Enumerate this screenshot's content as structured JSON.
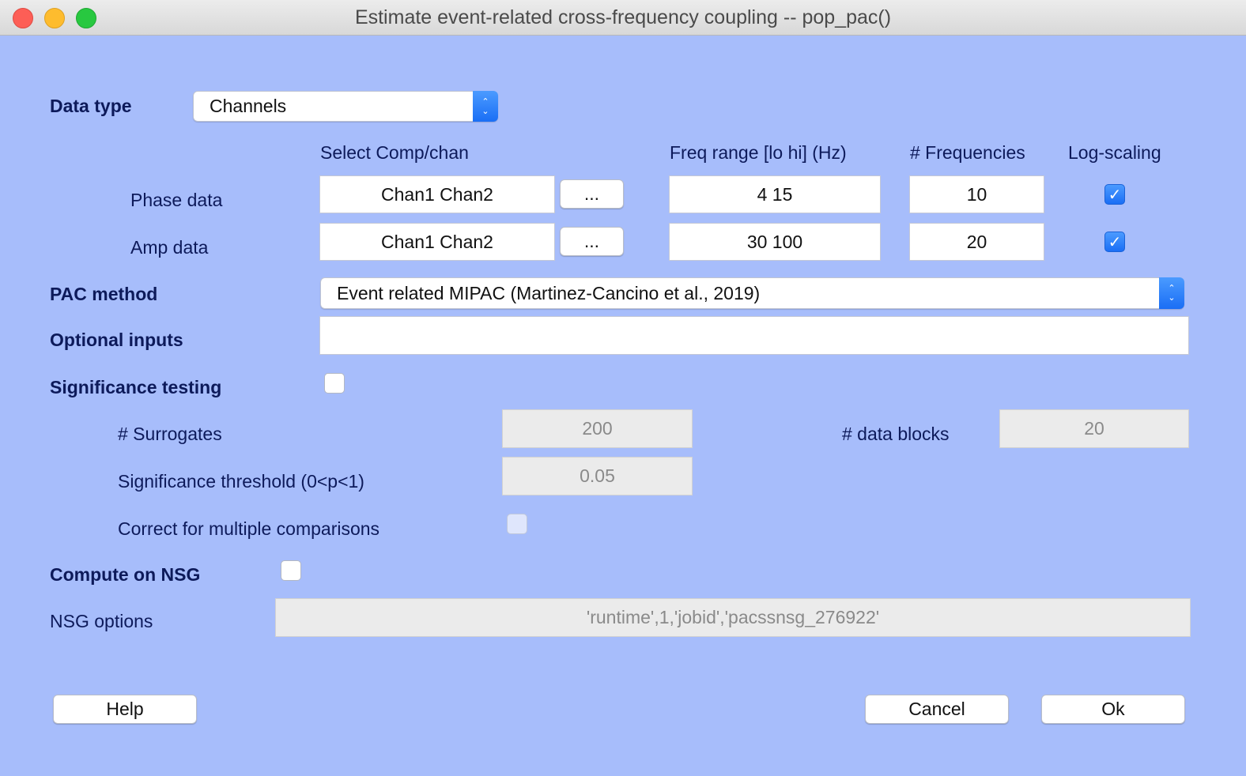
{
  "window": {
    "title": "Estimate event-related cross-frequency coupling -- pop_pac()"
  },
  "data_type": {
    "label": "Data type",
    "value": "Channels"
  },
  "headers": {
    "select": "Select Comp/chan",
    "freq": "Freq range [lo hi] (Hz)",
    "nfreq": "# Frequencies",
    "log": "Log-scaling"
  },
  "phase": {
    "label": "Phase data",
    "chans": "Chan1 Chan2",
    "browse": "...",
    "freq": "4  15",
    "nfreq": "10",
    "log": true
  },
  "amp": {
    "label": "Amp data",
    "chans": "Chan1 Chan2",
    "browse": "...",
    "freq": "30 100",
    "nfreq": "20",
    "log": true
  },
  "pac_method": {
    "label": "PAC method",
    "value": "Event related MIPAC (Martinez-Cancino et al., 2019)"
  },
  "optional": {
    "label": "Optional inputs",
    "value": ""
  },
  "significance": {
    "label": "Significance testing",
    "checked": false,
    "surrogates_label": "# Surrogates",
    "surrogates": "200",
    "blocks_label": "# data blocks",
    "blocks": "20",
    "threshold_label": "Significance threshold (0<p<1)",
    "threshold": "0.05",
    "correct_label": "Correct for multiple comparisons"
  },
  "nsg": {
    "label": "Compute on NSG",
    "checked": false,
    "options_label": "NSG options",
    "options": "'runtime',1,'jobid','pacssnsg_276922'"
  },
  "buttons": {
    "help": "Help",
    "cancel": "Cancel",
    "ok": "Ok"
  }
}
